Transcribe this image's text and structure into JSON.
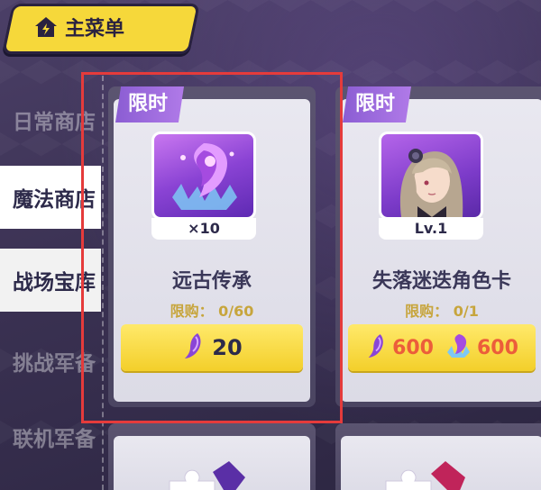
{
  "main_menu": {
    "label": "主菜单",
    "icon": "home-lightning-icon"
  },
  "sidebar": {
    "items": [
      {
        "label": "日常商店",
        "state": "normal"
      },
      {
        "label": "魔法商店",
        "state": "selected"
      },
      {
        "label": "战场宝库",
        "state": "normal"
      },
      {
        "label": "挑战军备",
        "state": "dim"
      },
      {
        "label": "联机军备",
        "state": "dim"
      }
    ]
  },
  "cards": [
    {
      "tag": "限时",
      "icon": "ancient-heritage-crystal-icon",
      "quantity": "×10",
      "name": "远古传承",
      "limit": "限购： 0/60",
      "price_icon": "purple-feather-icon",
      "price": "20"
    },
    {
      "tag": "限时",
      "icon": "character-portrait-icon",
      "quantity": "Lv.1",
      "name": "失落迷迭角色卡",
      "limit": "限购： 0/1",
      "prices": [
        {
          "icon": "purple-feather-icon",
          "value": "600"
        },
        {
          "icon": "purple-crystal-icon",
          "value": "600"
        }
      ]
    }
  ],
  "colors": {
    "accent_yellow": "#f6d83a",
    "tag_purple": "#9b6adf",
    "highlight_red": "#e53b3b",
    "price_red": "#ec5d3a"
  }
}
